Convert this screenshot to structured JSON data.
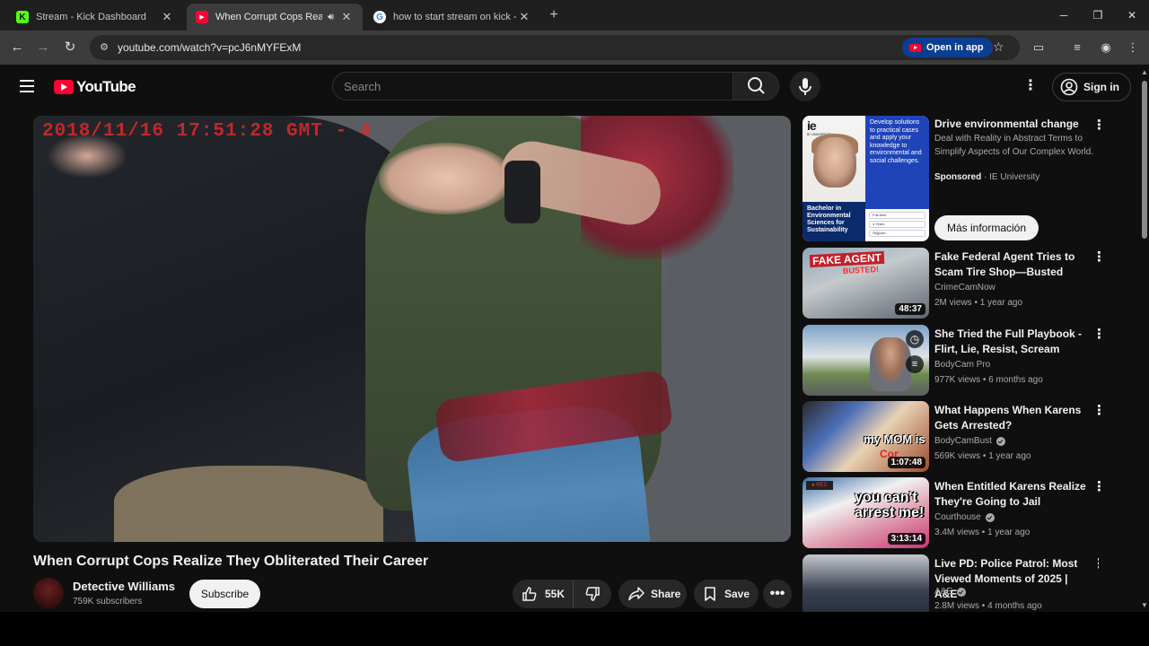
{
  "browser": {
    "tabs": [
      {
        "title": "Stream - Kick Dashboard",
        "favicon": "kick-icon",
        "active": false
      },
      {
        "title": "When Corrupt Cops Realize",
        "favicon": "youtube-icon",
        "active": true,
        "audio": "speaker-icon"
      },
      {
        "title": "how to start stream on kick - G",
        "favicon": "google-icon",
        "active": false
      }
    ],
    "url": "youtube.com/watch?v=pcJ6nMYFExM",
    "open_in_app": "Open in app"
  },
  "youtube": {
    "logo_text": "YouTube",
    "search_placeholder": "Search",
    "sign_in": "Sign in"
  },
  "video": {
    "overlay_timestamp": "2018/11/16  17:51:28 GMT - 4",
    "title": "When Corrupt Cops Realize They Obliterated Their Career",
    "channel": "Detective Williams",
    "subscribers": "759K subscribers",
    "subscribe_label": "Subscribe",
    "likes": "55K",
    "share_label": "Share",
    "save_label": "Save"
  },
  "ad": {
    "brand_short": "ie",
    "brand_sub": "IE UNIVERSITY",
    "thumb_tag": "Bachelor in Environmental Sciences for Sustainability",
    "thumb_right_text": "Develop solutions to practical cases and apply your knowledge to environmental and social challenges.",
    "form_fields": [
      "Full-time",
      "4 Years",
      "Segovia"
    ],
    "title": "Drive environmental change",
    "description": "Deal with Reality in Abstract Terms to Simplify Aspects of Our Complex World.",
    "sponsored_label": "Sponsored",
    "sponsor": "IE University",
    "cta": "Más información"
  },
  "recommendations": [
    {
      "title": "Fake Federal Agent Tries to Scam Tire Shop—Busted",
      "channel": "CrimeCamNow",
      "verified": false,
      "views": "2M views",
      "age": "1 year ago",
      "duration": "48:37",
      "thumb_text": "FAKE AGENT",
      "thumb_text2": "BUSTED!"
    },
    {
      "title": "She Tried the Full Playbook - Flirt, Lie, Resist, Scream",
      "channel": "BodyCam Pro",
      "verified": false,
      "views": "977K views",
      "age": "6 months ago",
      "duration": ""
    },
    {
      "title": "What Happens When Karens Gets Arrested?",
      "channel": "BodyCamBust",
      "verified": true,
      "views": "569K views",
      "age": "1 year ago",
      "duration": "1:07:48",
      "thumb_text": "my MOM is",
      "thumb_text2": "Cor"
    },
    {
      "title": "When Entitled Karens Realize They're Going to Jail",
      "channel": "Courthouse",
      "verified": true,
      "views": "3.4M views",
      "age": "1 year ago",
      "duration": "3:13:14",
      "thumb_text": "you can't arrest me!"
    },
    {
      "title": "Live PD: Police Patrol: Most Viewed Moments of 2025 | A&E",
      "channel": "A&E",
      "verified": true,
      "views": "2.8M views",
      "age": "4 months ago",
      "duration": ""
    }
  ],
  "colors": {
    "background": "#0f0f0f",
    "youtube_red": "#ff0033",
    "open_in_app_bg": "#0b3d91"
  }
}
